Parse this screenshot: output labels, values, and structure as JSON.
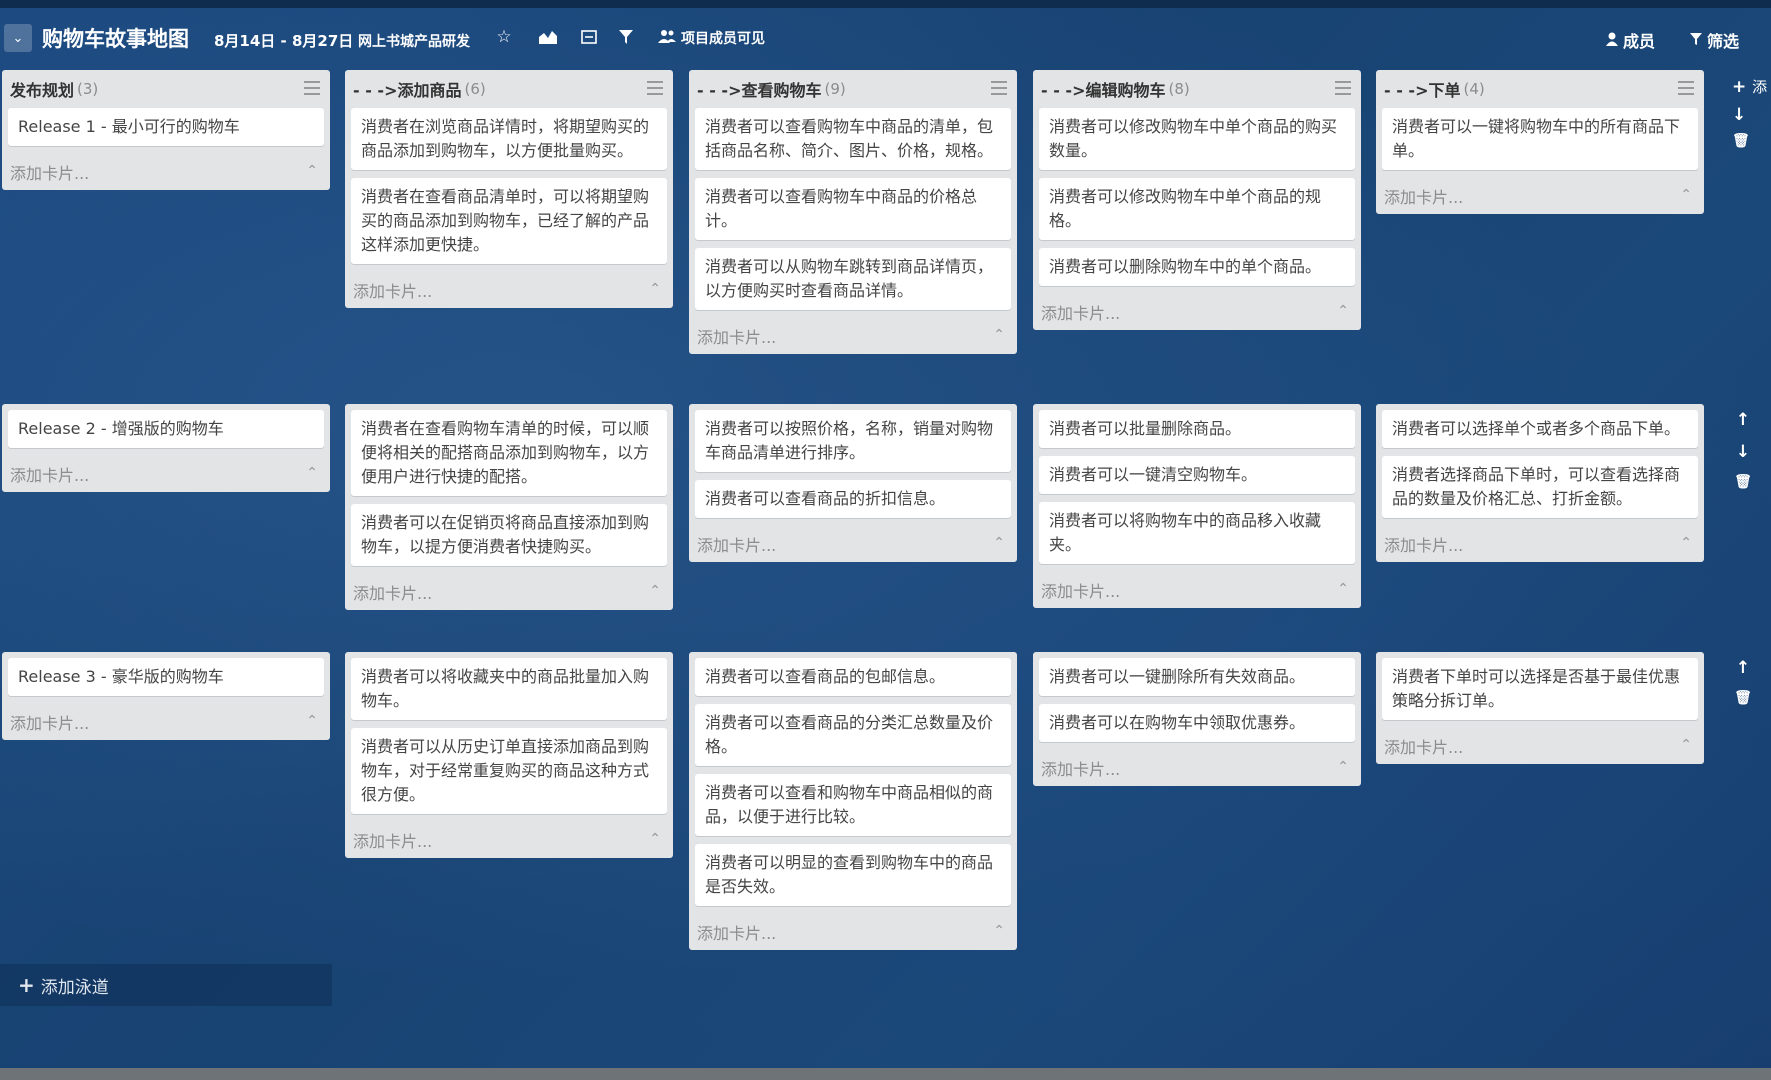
{
  "header": {
    "menu_icon": "chevron-down-icon",
    "title": "购物车故事地图",
    "dates": "8月14日 - 8月27日",
    "team": "网上书城产品研发",
    "visibility": "项目成员可见",
    "members": "成员",
    "filter": "筛选"
  },
  "add_card_label": "添加卡片...",
  "add_lane_label": "添加泳道",
  "lane_add_label": "添",
  "lanes": [
    {
      "lists": [
        {
          "title": "发布规划",
          "count": "(3)",
          "cards": [
            "Release 1 - 最小可行的购物车"
          ]
        },
        {
          "title": "- - ->添加商品",
          "count": "(6)",
          "cards": [
            "消费者在浏览商品详情时，将期望购买的商品添加到购物车，以方便批量购买。",
            "消费者在查看商品清单时，可以将期望购买的商品添加到购物车，已经了解的产品这样添加更快捷。"
          ]
        },
        {
          "title": "- - ->查看购物车",
          "count": "(9)",
          "cards": [
            "消费者可以查看购物车中商品的清单，包括商品名称、简介、图片、价格，规格。",
            "消费者可以查看购物车中商品的价格总计。",
            "消费者可以从购物车跳转到商品详情页，以方便购买时查看商品详情。"
          ]
        },
        {
          "title": "- - ->编辑购物车",
          "count": "(8)",
          "cards": [
            "消费者可以修改购物车中单个商品的购买数量。",
            "消费者可以修改购物车中单个商品的规格。",
            "消费者可以删除购物车中的单个商品。"
          ]
        },
        {
          "title": "- - ->下单",
          "count": "(4)",
          "cards": [
            "消费者可以一键将购物车中的所有商品下单。"
          ]
        }
      ]
    },
    {
      "lists": [
        {
          "cards": [
            "Release 2 - 增强版的购物车"
          ]
        },
        {
          "cards": [
            "消费者在查看购物车清单的时候，可以顺便将相关的配搭商品添加到购物车，以方便用户进行快捷的配搭。",
            "消费者可以在促销页将商品直接添加到购物车，以提方便消费者快捷购买。"
          ]
        },
        {
          "cards": [
            "消费者可以按照价格，名称，销量对购物车商品清单进行排序。",
            "消费者可以查看商品的折扣信息。"
          ]
        },
        {
          "cards": [
            "消费者可以批量删除商品。",
            "消费者可以一键清空购物车。",
            "消费者可以将购物车中的商品移入收藏夹。"
          ]
        },
        {
          "cards": [
            "消费者可以选择单个或者多个商品下单。",
            "消费者选择商品下单时，可以查看选择商品的数量及价格汇总、打折金额。"
          ]
        }
      ]
    },
    {
      "lists": [
        {
          "cards": [
            "Release 3 - 豪华版的购物车"
          ]
        },
        {
          "cards": [
            "消费者可以将收藏夹中的商品批量加入购物车。",
            "消费者可以从历史订单直接添加商品到购物车，对于经常重复购买的商品这种方式很方便。"
          ]
        },
        {
          "cards": [
            "消费者可以查看商品的包邮信息。",
            "消费者可以查看商品的分类汇总数量及价格。",
            "消费者可以查看和购物车中商品相似的商品，以便于进行比较。",
            "消费者可以明显的查看到购物车中的商品是否失效。"
          ]
        },
        {
          "cards": [
            "消费者可以一键删除所有失效商品。",
            "消费者可以在购物车中领取优惠券。"
          ]
        },
        {
          "cards": [
            "消费者下单时可以选择是否基于最佳优惠策略分拆订单。"
          ]
        }
      ]
    }
  ]
}
